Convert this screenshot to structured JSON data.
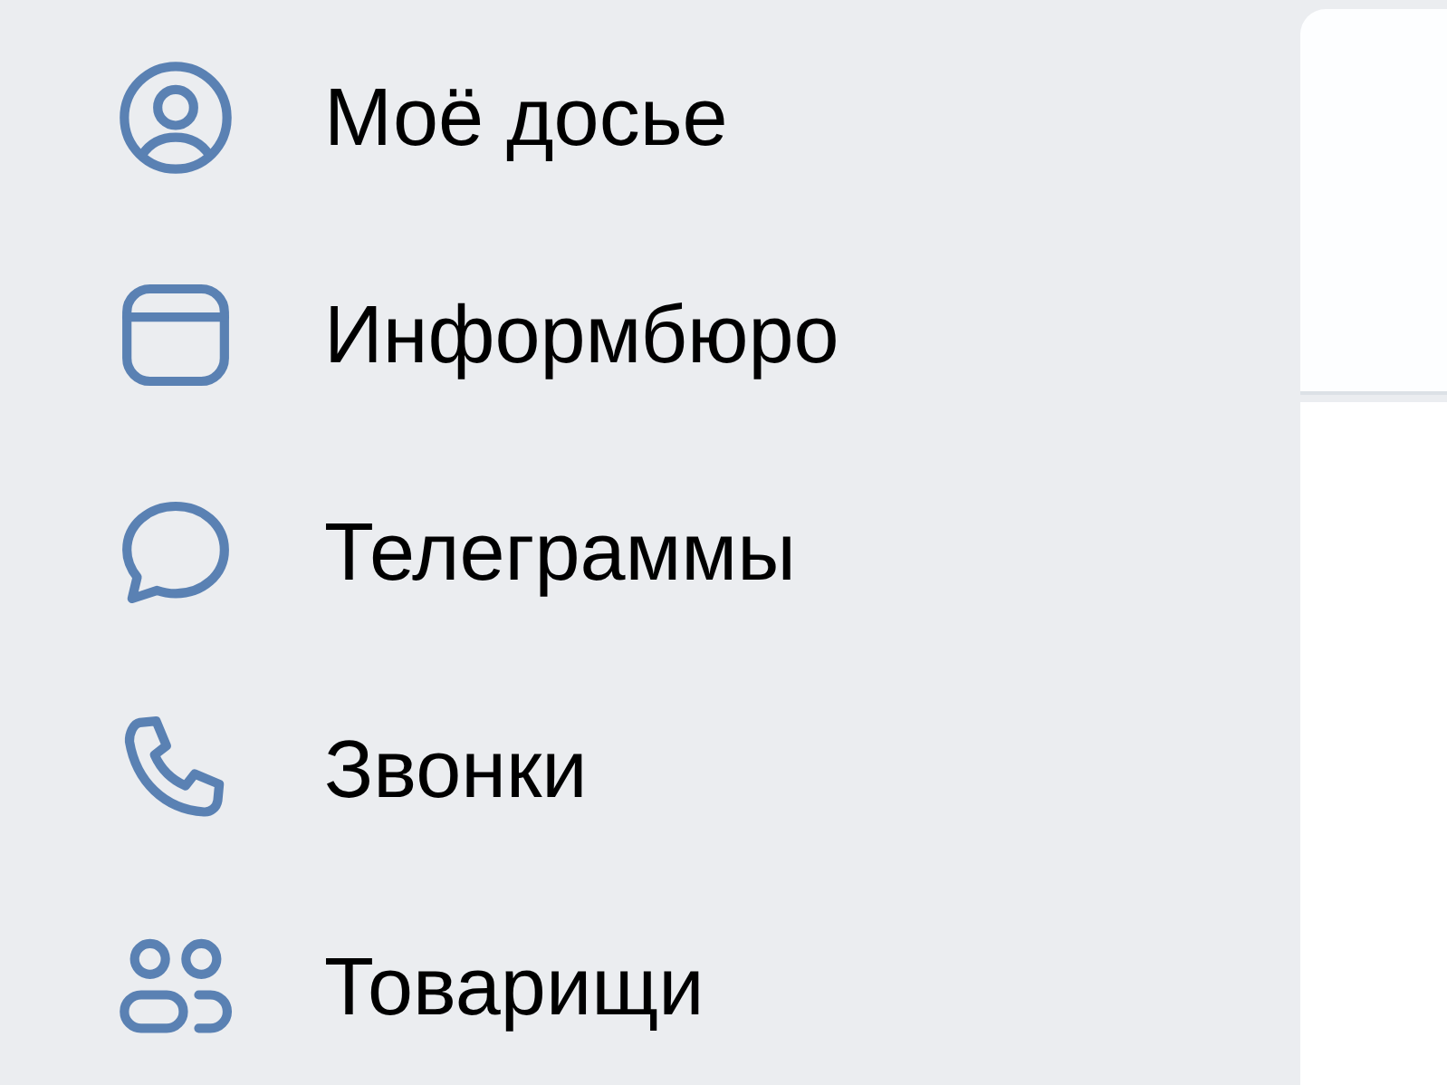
{
  "menu": [
    {
      "label": "Моё досье"
    },
    {
      "label": "Информбюро"
    },
    {
      "label": "Телеграммы"
    },
    {
      "label": "Звонки"
    },
    {
      "label": "Товарищи"
    }
  ]
}
